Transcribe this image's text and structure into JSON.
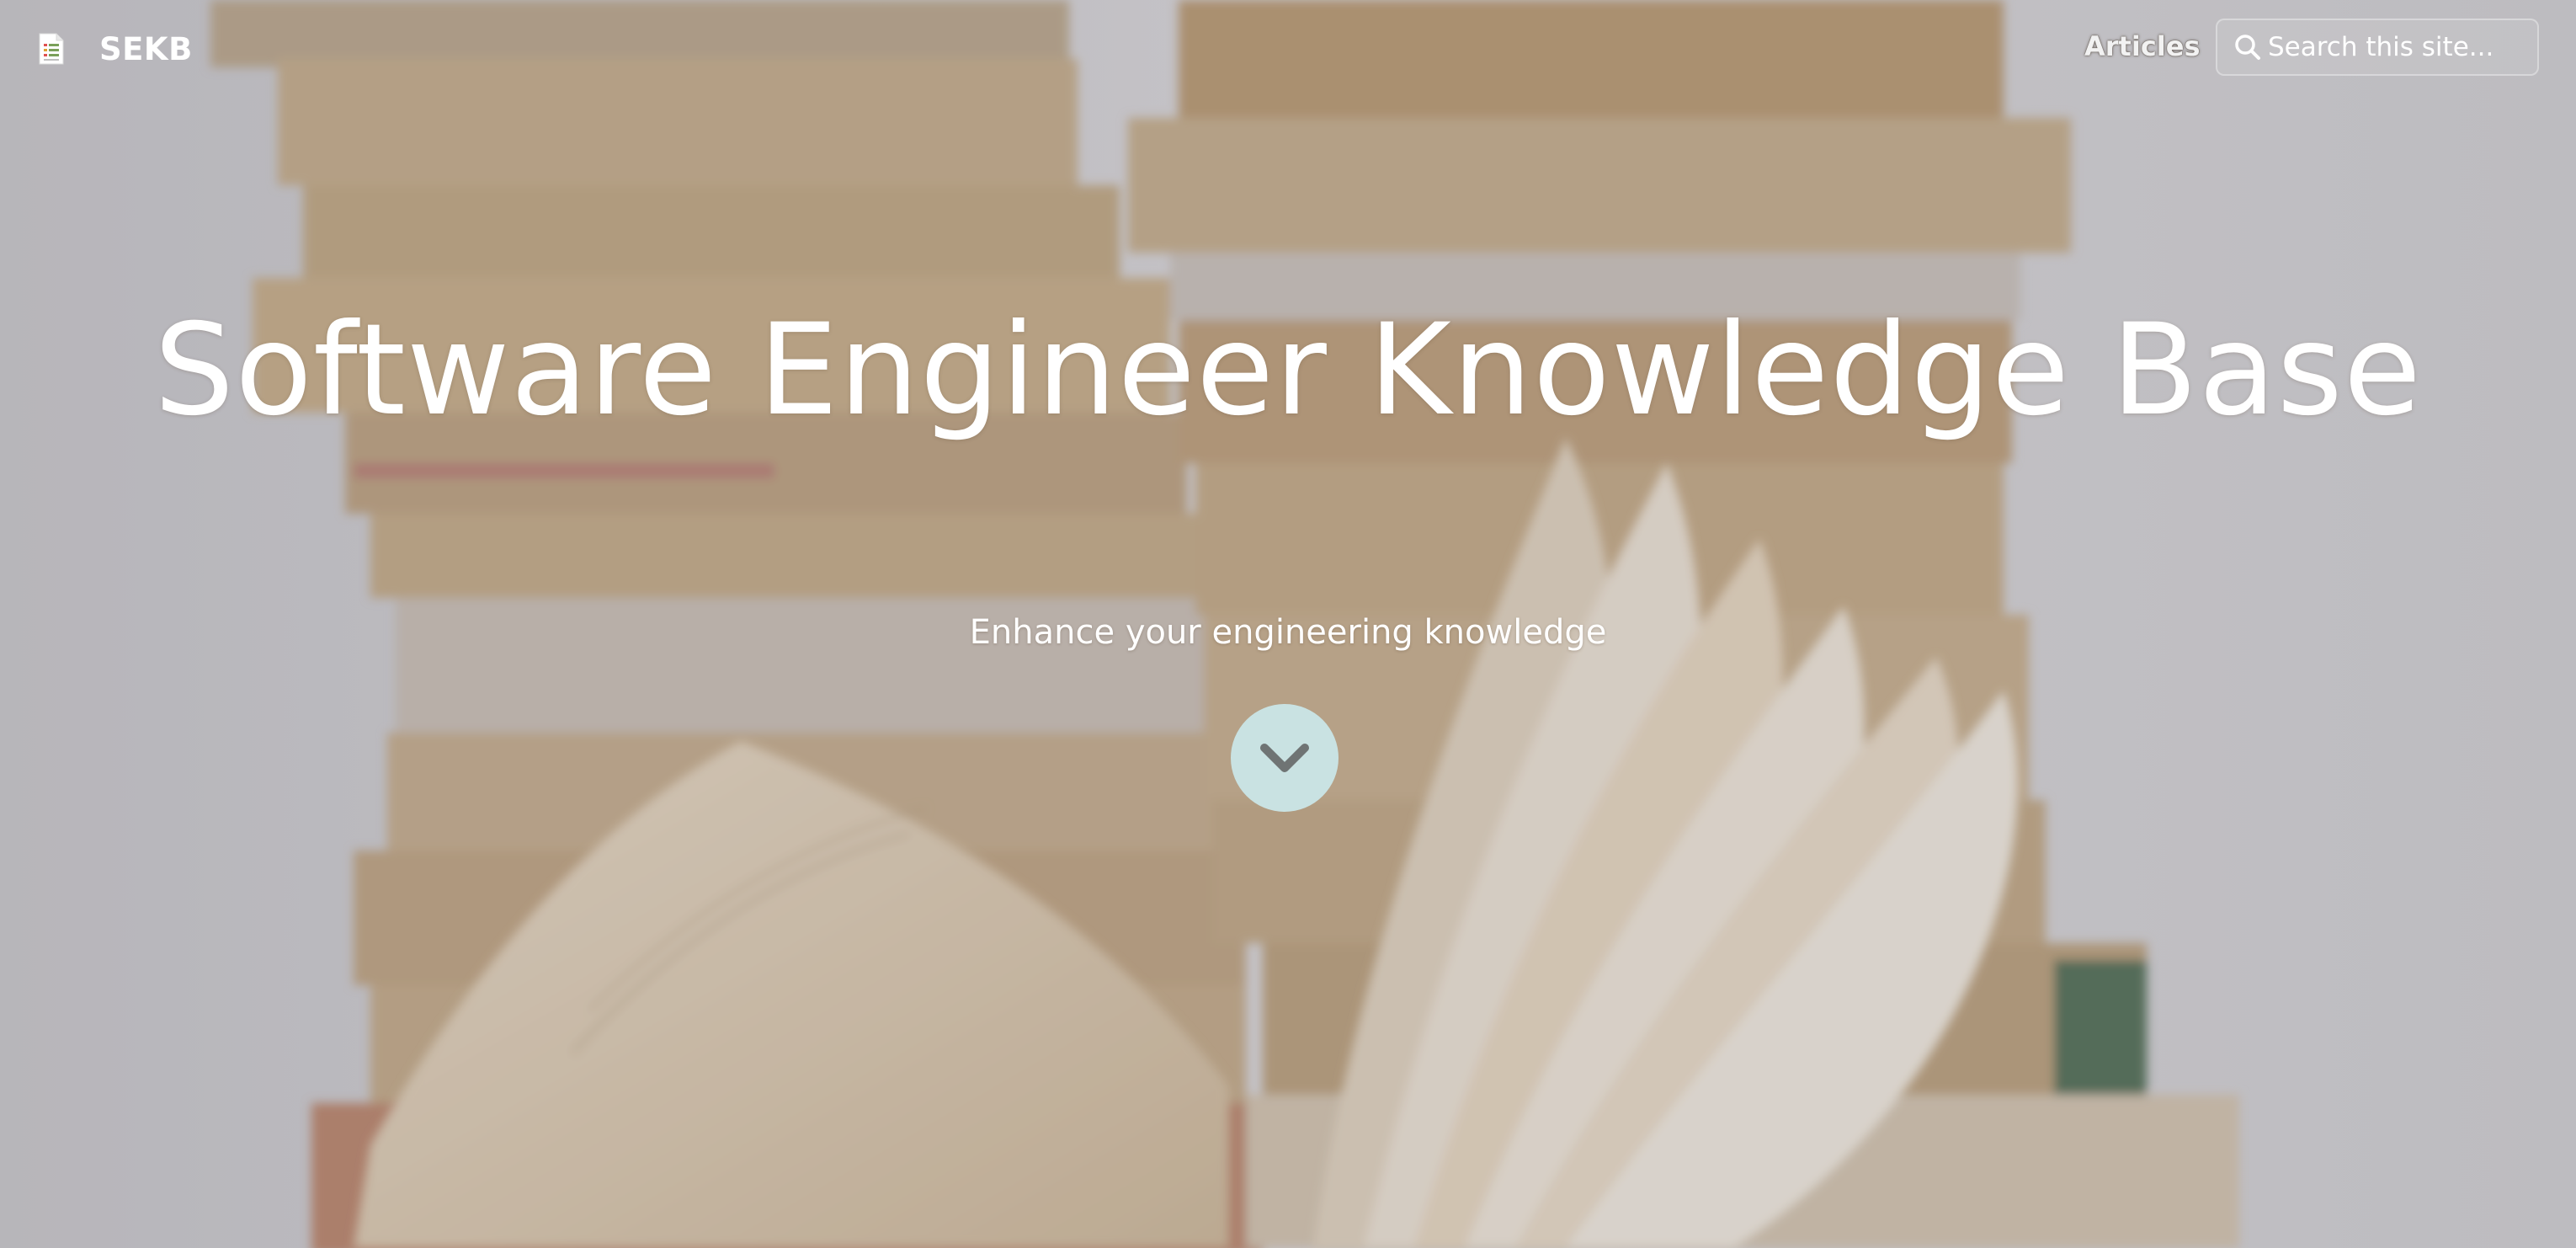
{
  "brand": {
    "name": "SEKB",
    "icon": "document-icon"
  },
  "nav": {
    "articles_label": "Articles"
  },
  "search": {
    "placeholder": "Search this site...",
    "icon": "search-icon"
  },
  "hero": {
    "title": "Software Engineer Knowledge Base",
    "subtitle": "Enhance your engineering knowledge",
    "scroll_icon": "chevron-down-icon"
  },
  "colors": {
    "scroll_button": "#c9e2e2",
    "text": "#ffffff"
  }
}
